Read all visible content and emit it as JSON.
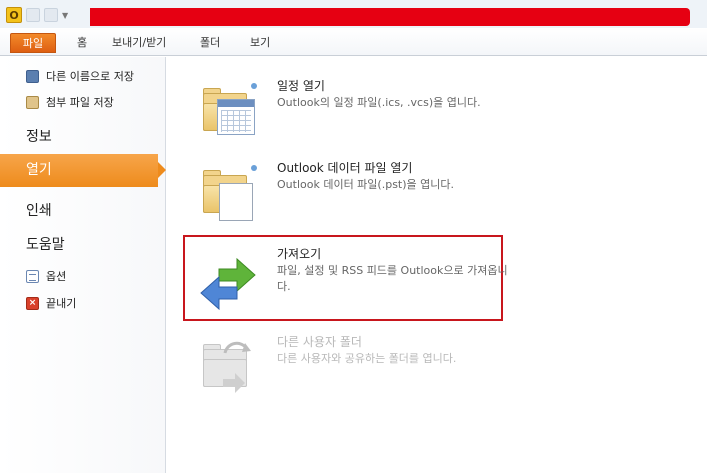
{
  "window": {
    "app_icon_letter": "O"
  },
  "ribbon": {
    "tabs": [
      {
        "label": "파일",
        "active": true
      },
      {
        "label": "홈"
      },
      {
        "label": "보내기/받기"
      },
      {
        "label": "폴더"
      },
      {
        "label": "보기"
      }
    ]
  },
  "backstage": {
    "nav": {
      "save_as": "다른 이름으로 저장",
      "save_attachments": "첨부 파일 저장",
      "info": "정보",
      "open": "열기",
      "print": "인쇄",
      "help": "도움말",
      "options": "옵션",
      "exit": "끝내기"
    },
    "open_items": [
      {
        "title": "일정 열기",
        "desc": "Outlook의 일정 파일(.ics, .vcs)을 엽니다.",
        "icon": "calendar-folder-icon"
      },
      {
        "title": "Outlook 데이터 파일 열기",
        "desc": "Outlook 데이터 파일(.pst)을 엽니다.",
        "icon": "data-file-folder-icon"
      },
      {
        "title": "가져오기",
        "desc": "파일, 설정 및 RSS 피드를 Outlook으로 가져옵니다.",
        "icon": "import-arrows-icon",
        "highlighted": true
      },
      {
        "title": "다른 사용자 폴더",
        "desc": "다른 사용자와 공유하는 폴더를 엽니다.",
        "icon": "shared-folder-icon",
        "disabled": true
      }
    ]
  },
  "colors": {
    "accent_orange": "#ee8b1c",
    "highlight_red": "#c8161d",
    "redaction_red": "#e60012"
  }
}
